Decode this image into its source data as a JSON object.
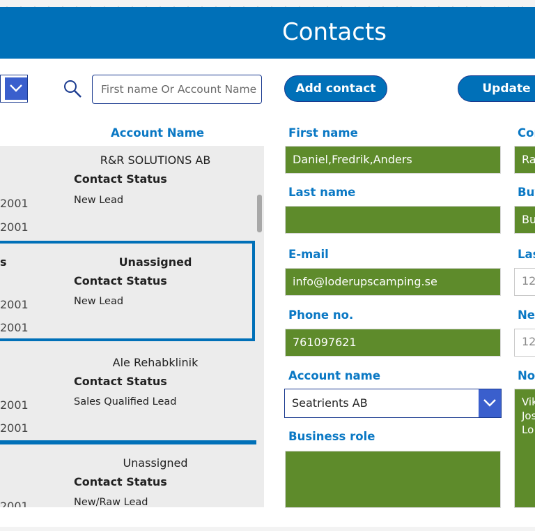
{
  "header": {
    "title": "Contacts"
  },
  "toolbar": {
    "search_placeholder": "First name Or Account Name",
    "add_contact_label": "Add contact",
    "update_label": "Update"
  },
  "list": {
    "account_name_header": "Account Name",
    "items": [
      {
        "left_title": "",
        "account": "R&R SOLUTIONS AB",
        "status_label": "Contact Status",
        "status_value": "New Lead",
        "date1": "2001",
        "date2": "2001"
      },
      {
        "left_title": "s",
        "account": "Unassigned",
        "status_label": "Contact Status",
        "status_value": "New Lead",
        "date1": "2001",
        "date2": "2001"
      },
      {
        "left_title": "",
        "account": "Ale Rehabklinik",
        "status_label": "Contact Status",
        "status_value": "Sales Qualified Lead",
        "date1": "2001",
        "date2": "2001"
      },
      {
        "left_title": "",
        "account": "Unassigned",
        "status_label": "Contact Status",
        "status_value": "New/Raw Lead",
        "date1": "2001",
        "date2": ""
      }
    ]
  },
  "form": {
    "first_name_label": "First name",
    "first_name_value": "Daniel,Fredrik,Anders",
    "last_name_label": "Last name",
    "last_name_value": "",
    "email_label": "E-mail",
    "email_value": "info@loderupscamping.se",
    "phone_label": "Phone no.",
    "phone_value": "761097621",
    "account_name_label": "Account name",
    "account_name_value": "Seatrients AB",
    "business_role_label": "Business role",
    "business_role_value": "",
    "right_col_labels": [
      "Cor",
      "Buy",
      "Las",
      "Nex",
      "Not"
    ],
    "right_col_values": [
      "Ra",
      "Bu",
      "12",
      "12"
    ],
    "notes_lines": [
      "Vik",
      "Jos",
      "Lo"
    ]
  },
  "colors": {
    "header_bg": "#0070b8",
    "field_green": "#5e8b2b",
    "label_blue": "#0a78c4",
    "gallery_bg": "#ececec",
    "dropdown_chevron": "#3a5fcd"
  },
  "icons": {
    "search": "search-icon",
    "dropdown": "chevron-down-icon"
  }
}
